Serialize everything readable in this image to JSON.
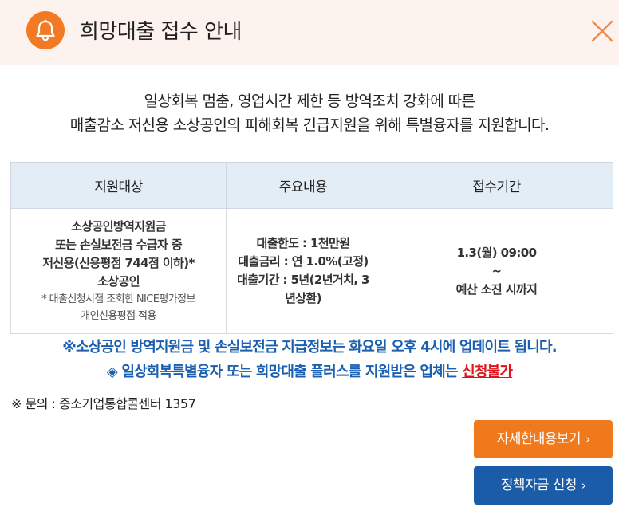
{
  "header": {
    "title": "희망대출 접수 안내",
    "accent_color": "#f37a25",
    "icon": "bell-icon",
    "close_icon": "close-icon"
  },
  "intro": {
    "line1": "일상회복 멈춤, 영업시간 제한 등 방역조치 강화에 따른",
    "line2": "매출감소 저신용 소상공인의 피해회복 긴급지원을 위해 특별융자를 지원합니다."
  },
  "table": {
    "headers": [
      "지원대상",
      "주요내용",
      "접수기간"
    ],
    "target": {
      "line1": "소상공인방역지원금",
      "line2": "또는 손실보전금 수급자 중",
      "line3": "저신용(신용평점 744점 이하)*",
      "line4": "소상공인",
      "note1": "* 대출신청시점 조회한 NICE평가정보",
      "note2": "개인신용평점 적용"
    },
    "content": {
      "line1": "대출한도 : 1천만원",
      "line2": "대출금리 : 연 1.0%(고정)",
      "line3": "대출기간 : 5년(2년거치, 3",
      "line4": "년상환)"
    },
    "period": {
      "line1": "1.3(월) 09:00",
      "line2": "~",
      "line3": "예산 소진 시까지"
    }
  },
  "notices": {
    "line1": "※소상공인 방역지원금 및 손실보전금 지급정보는 화요일 오후 4시에 업데이트 됩니다.",
    "line2_prefix": "◈ 일상회복특별융자 또는 희망대출 플러스를 지원받은 업체는 ",
    "line2_highlight": "신청불가",
    "highlight_color": "#e0121a",
    "notice_color": "#1b5fb0"
  },
  "contact": "※ 문의 : 중소기업통합콜센터 1357",
  "buttons": {
    "detail": "자세한내용보기",
    "apply": "정책자금 신청",
    "chevron": "›"
  }
}
